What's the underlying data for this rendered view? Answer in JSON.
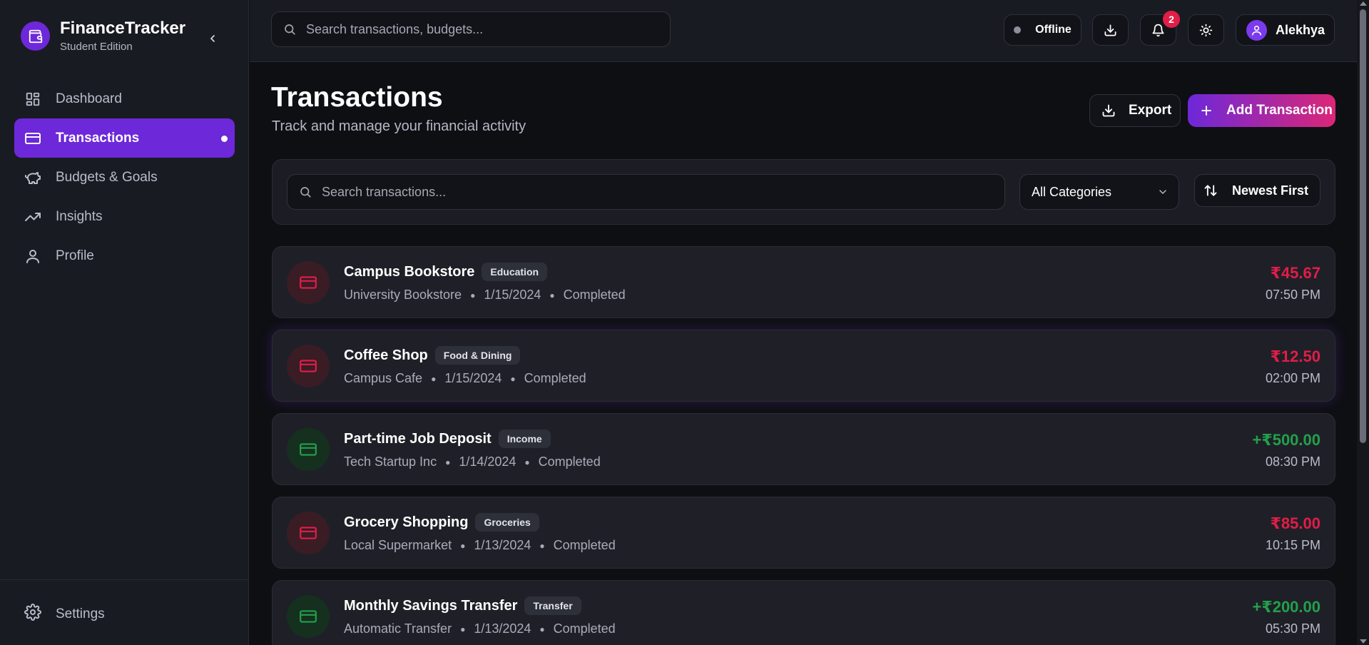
{
  "app": {
    "title": "FinanceTracker",
    "subtitle": "Student Edition"
  },
  "sidebar": {
    "items": [
      {
        "label": "Dashboard",
        "icon": "dashboard-icon"
      },
      {
        "label": "Transactions",
        "icon": "credit-card-icon",
        "active": true
      },
      {
        "label": "Budgets & Goals",
        "icon": "piggy-bank-icon"
      },
      {
        "label": "Insights",
        "icon": "trending-up-icon"
      },
      {
        "label": "Profile",
        "icon": "user-icon"
      }
    ],
    "settings_label": "Settings"
  },
  "topbar": {
    "search_placeholder": "Search transactions, budgets...",
    "status_label": "Offline",
    "notification_count": "2",
    "user_name": "Alekhya"
  },
  "page": {
    "title": "Transactions",
    "subtitle": "Track and manage your financial activity",
    "export_label": "Export",
    "add_label": "Add Transaction"
  },
  "filters": {
    "search_placeholder": "Search transactions...",
    "category_value": "All Categories",
    "sort_value": "Newest First"
  },
  "transactions": [
    {
      "name": "Campus Bookstore",
      "category": "Education",
      "merchant": "University Bookstore",
      "date": "1/15/2024",
      "status": "Completed",
      "amount": "₹45.67",
      "time": "07:50 PM",
      "direction": "out"
    },
    {
      "name": "Coffee Shop",
      "category": "Food & Dining",
      "merchant": "Campus Cafe",
      "date": "1/15/2024",
      "status": "Completed",
      "amount": "₹12.50",
      "time": "02:00 PM",
      "direction": "out"
    },
    {
      "name": "Part-time Job Deposit",
      "category": "Income",
      "merchant": "Tech Startup Inc",
      "date": "1/14/2024",
      "status": "Completed",
      "amount": "+₹500.00",
      "time": "08:30 PM",
      "direction": "in"
    },
    {
      "name": "Grocery Shopping",
      "category": "Groceries",
      "merchant": "Local Supermarket",
      "date": "1/13/2024",
      "status": "Completed",
      "amount": "₹85.00",
      "time": "10:15 PM",
      "direction": "out"
    },
    {
      "name": "Monthly Savings Transfer",
      "category": "Transfer",
      "merchant": "Automatic Transfer",
      "date": "1/13/2024",
      "status": "Completed",
      "amount": "+₹200.00",
      "time": "05:30 PM",
      "direction": "in"
    }
  ],
  "colors": {
    "accent": "#6d28d9",
    "expense": "#e11d48",
    "income": "#22a04b",
    "background": "#0e0f13",
    "panel": "#191b22"
  }
}
